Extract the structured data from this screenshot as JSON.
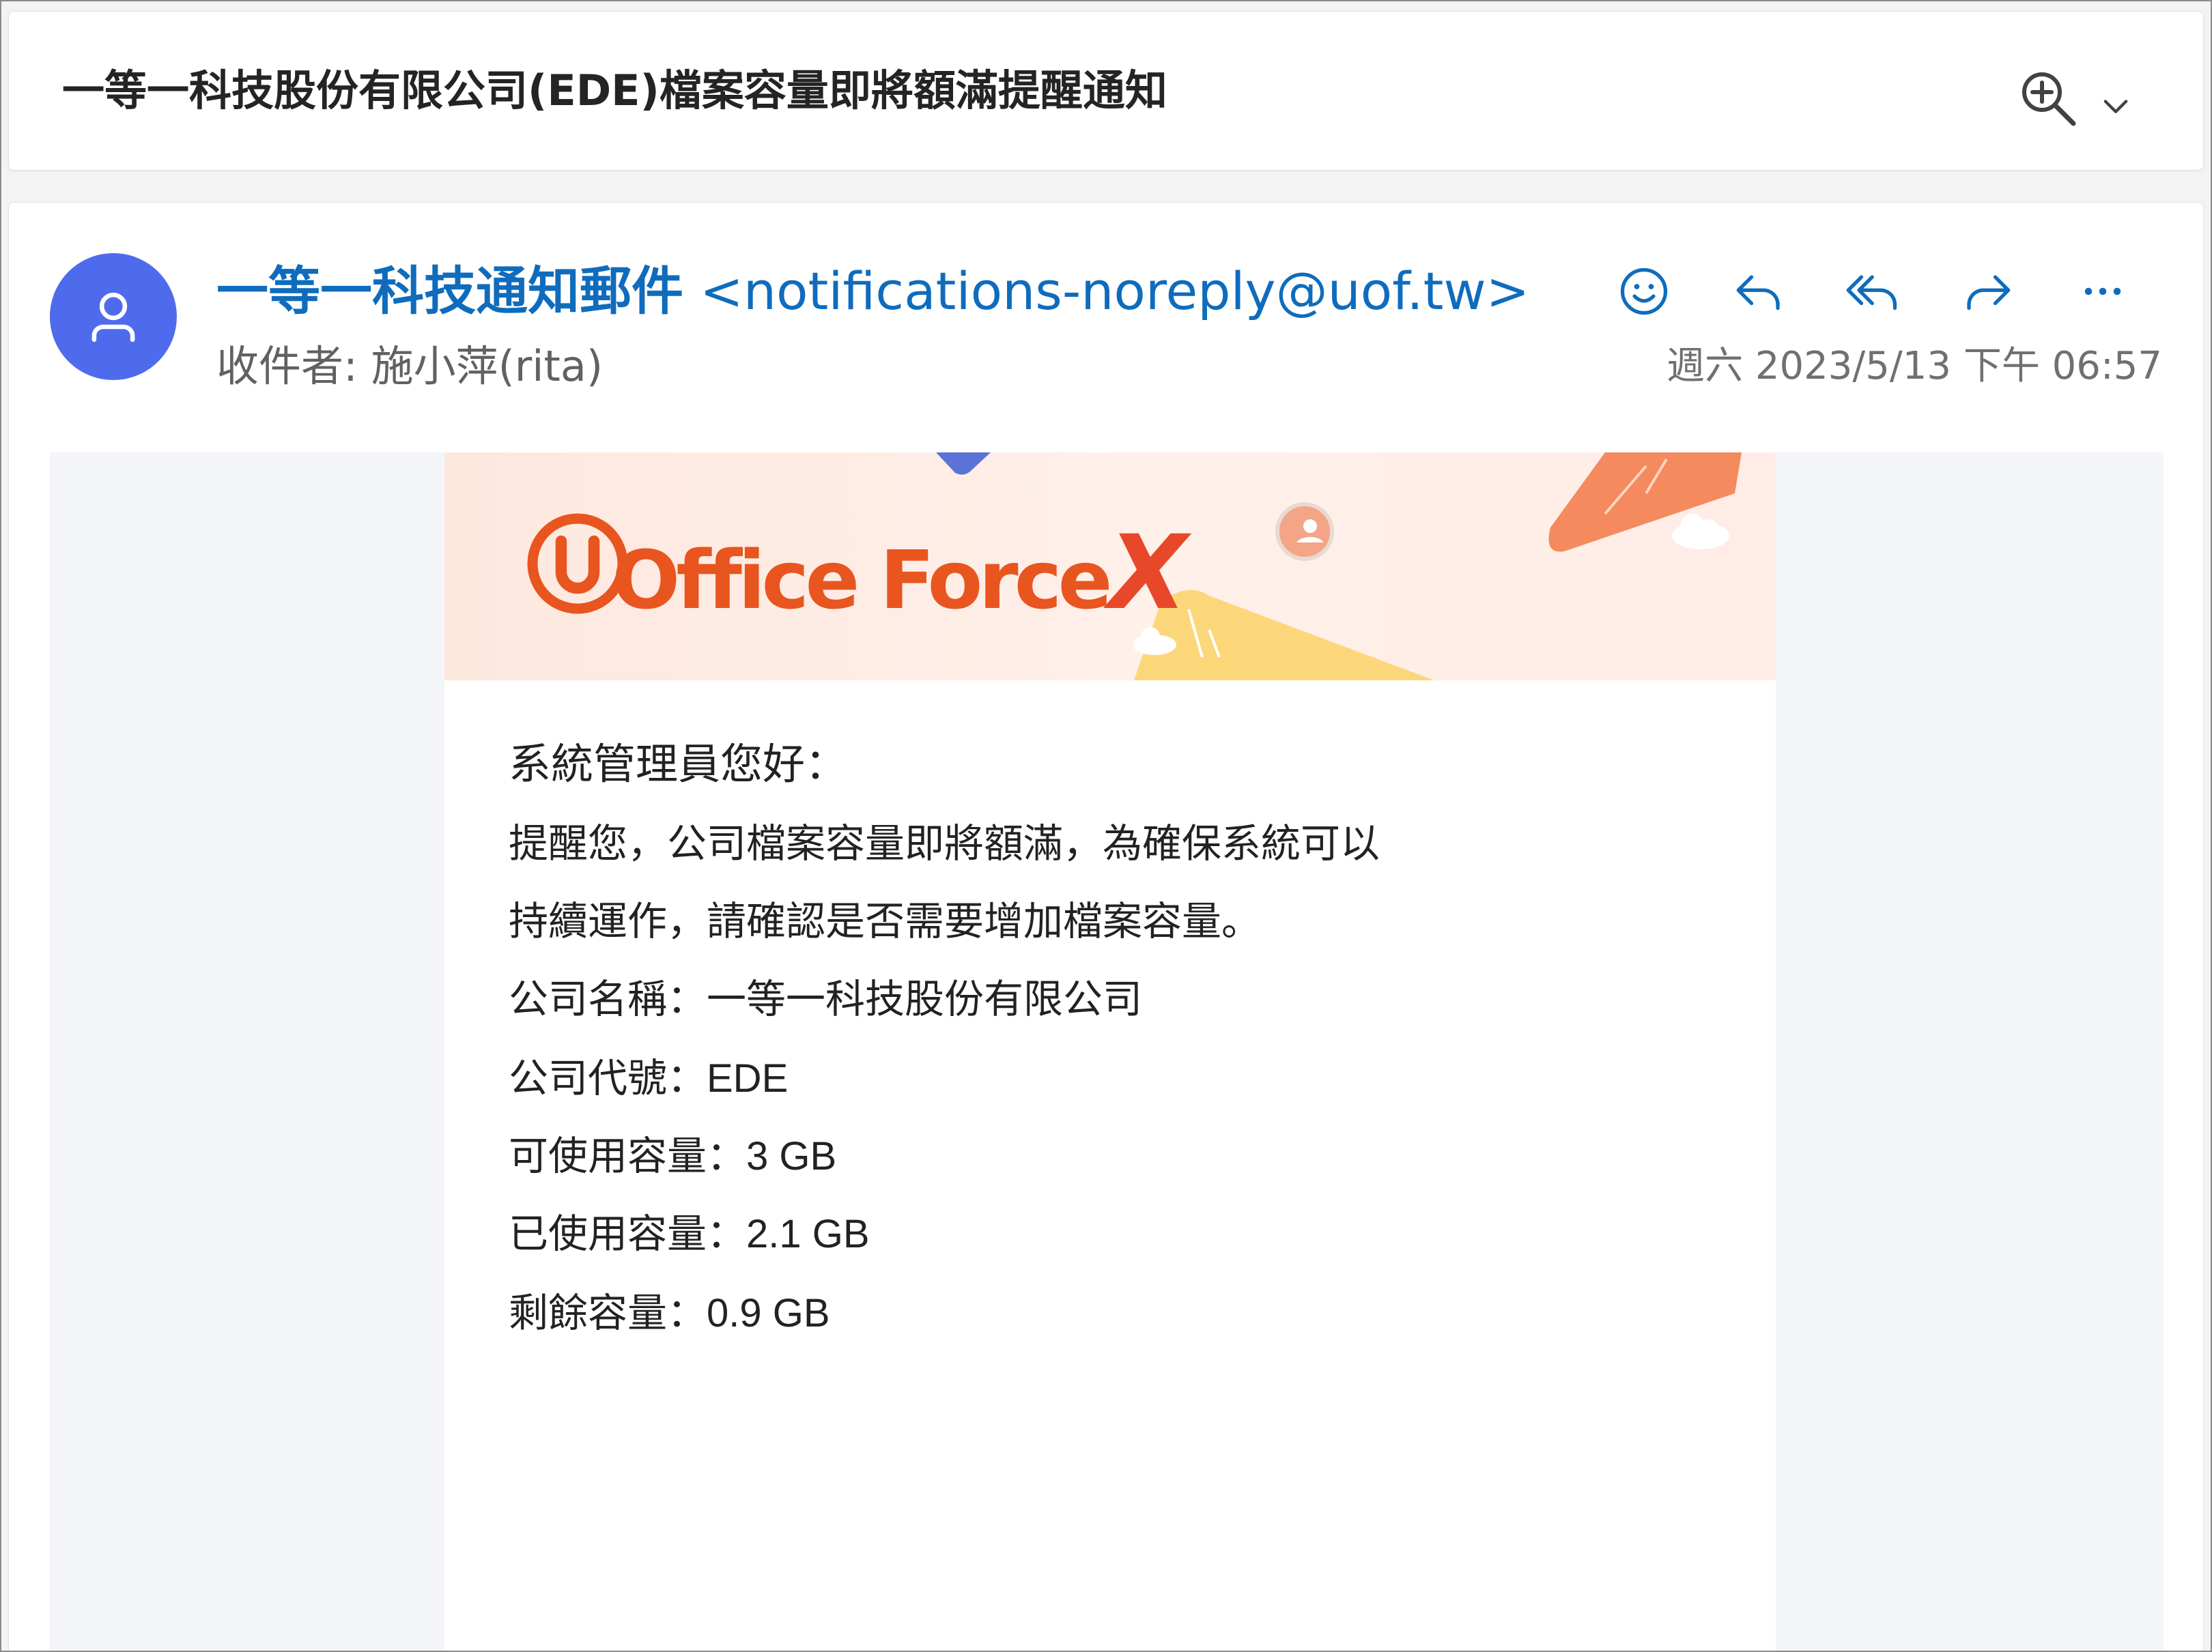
{
  "subject": {
    "title": "一等一科技股份有限公司(EDE)檔案容量即將額滿提醒通知"
  },
  "message": {
    "sender_name": "一等一科技通知郵件",
    "sender_email": "<notifications-noreply@uof.tw>",
    "recipient_label": "收件者:",
    "recipient_name": "施小萍(rita)",
    "timestamp": "週六 2023/5/13 下午 06:57"
  },
  "banner": {
    "logo_text": "Office Force",
    "logo_x": "X",
    "brand_color": "#e8551f"
  },
  "body": {
    "greeting": "系統管理員您好：",
    "paragraph_line1": "提醒您，公司檔案容量即將額滿，為確保系統可以",
    "paragraph_line2": "持續運作，請確認是否需要增加檔案容量。",
    "company_name": "公司名稱：一等一科技股份有限公司",
    "company_code": "公司代號：EDE",
    "available": "可使用容量：3 GB",
    "used": "已使用容量：2.1 GB",
    "remaining": "剩餘容量：0.9 GB"
  },
  "icons": {
    "zoom": "zoom-in-icon",
    "chevron": "chevron-down-icon",
    "emoji": "smiley-icon",
    "reply": "reply-icon",
    "reply_all": "reply-all-icon",
    "forward": "forward-icon",
    "more": "more-icon"
  },
  "colors": {
    "accent": "#0f6cbd",
    "avatar_bg": "#4f6bed"
  }
}
